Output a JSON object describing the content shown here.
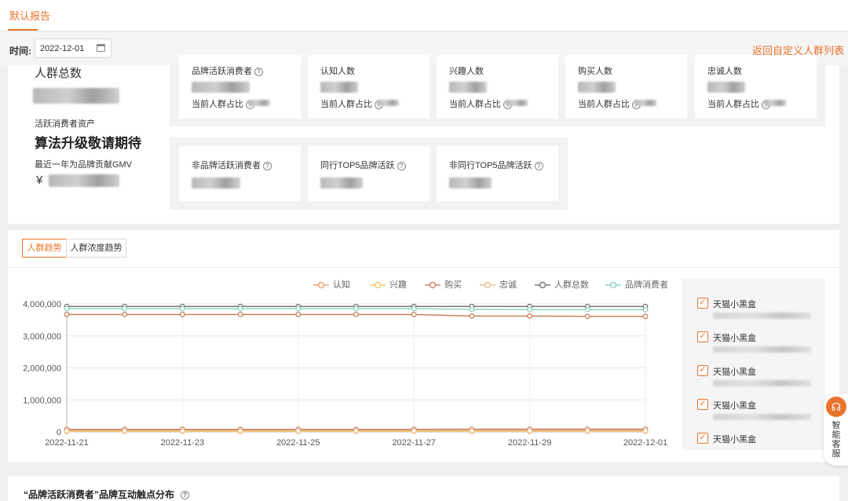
{
  "header": {
    "tab_label": "默认报告"
  },
  "filter": {
    "time_label": "时间:",
    "date_value": "2022-12-01",
    "back_link": "返回自定义人群列表"
  },
  "overview": {
    "total_label": "人群总数",
    "assets_label": "活跃消费者资产",
    "assets_value": "算法升级敬请期待",
    "gmv_label": "最近一年为品牌贡献GMV",
    "gmv_prefix": "¥"
  },
  "metric_cards_row1": [
    {
      "title": "品牌活跃消费者",
      "ratio_label": "当前人群占比"
    },
    {
      "title": "认知人数",
      "ratio_label": "当前人群占比"
    },
    {
      "title": "兴趣人数",
      "ratio_label": "当前人群占比"
    },
    {
      "title": "购买人数",
      "ratio_label": "当前人群占比"
    },
    {
      "title": "忠诚人数",
      "ratio_label": "当前人群占比"
    }
  ],
  "metric_cards_row2": [
    {
      "title": "非品牌活跃消费者"
    },
    {
      "title": "同行TOP5品牌活跃"
    },
    {
      "title": "非同行TOP5品牌活跃"
    }
  ],
  "trend": {
    "tabs": [
      "人群趋势",
      "人群浓度趋势"
    ],
    "active_tab": "人群趋势",
    "side_items": [
      "天猫小黑盒",
      "天猫小黑盒",
      "天猫小黑盒",
      "天猫小黑盒",
      "天猫小黑盒"
    ]
  },
  "chart_data": {
    "type": "line",
    "x": [
      "2022-11-21",
      "2022-11-22",
      "2022-11-23",
      "2022-11-24",
      "2022-11-25",
      "2022-11-26",
      "2022-11-27",
      "2022-11-28",
      "2022-11-29",
      "2022-11-30",
      "2022-12-01"
    ],
    "x_tick_labels": [
      "2022-11-21",
      "2022-11-23",
      "2022-11-25",
      "2022-11-27",
      "2022-11-29",
      "2022-12-01"
    ],
    "ylim": [
      0,
      4000000
    ],
    "y_ticks": [
      "0",
      "1,000,000",
      "2,000,000",
      "3,000,000",
      "4,000,000"
    ],
    "y_tick_values": [
      0,
      1000000,
      2000000,
      3000000,
      4000000
    ],
    "grid": true,
    "legend_position": "top",
    "series": [
      {
        "name": "认知",
        "color": "#f0a070",
        "values": [
          50000,
          50000,
          50000,
          50000,
          50000,
          50000,
          50000,
          55000,
          55000,
          55000,
          55000
        ]
      },
      {
        "name": "兴趣",
        "color": "#f5c96b",
        "values": [
          15000,
          15000,
          15000,
          15000,
          15000,
          15000,
          15000,
          15000,
          15000,
          15000,
          15000
        ]
      },
      {
        "name": "购买",
        "color": "#c98a6b",
        "values": [
          80000,
          80000,
          80000,
          80000,
          80000,
          80000,
          80000,
          85000,
          85000,
          85000,
          85000
        ]
      },
      {
        "name": "忠诚",
        "color": "#e8c48f",
        "values": [
          30000,
          30000,
          30000,
          30000,
          30000,
          30000,
          30000,
          30000,
          30000,
          30000,
          30000
        ]
      },
      {
        "name": "人群总数",
        "color": "#777777",
        "values": [
          3920000,
          3920000,
          3920000,
          3920000,
          3920000,
          3920000,
          3920000,
          3920000,
          3920000,
          3920000,
          3920000
        ]
      },
      {
        "name": "品牌消费者",
        "color": "#8fd3c4",
        "values": [
          3850000,
          3850000,
          3850000,
          3850000,
          3850000,
          3850000,
          3850000,
          3830000,
          3820000,
          3820000,
          3820000
        ]
      },
      {
        "name": "",
        "color": "#c9805f",
        "values": [
          3670000,
          3670000,
          3670000,
          3670000,
          3670000,
          3670000,
          3670000,
          3620000,
          3620000,
          3610000,
          3610000
        ]
      }
    ]
  },
  "support": {
    "label": "智能客服"
  },
  "touchpoint": {
    "title": "“品牌活跃消费者”品牌互动触点分布"
  },
  "icons": {
    "help": "?",
    "check": "✓",
    "headset": "☊"
  },
  "colors": {
    "accent": "#e8742c"
  }
}
